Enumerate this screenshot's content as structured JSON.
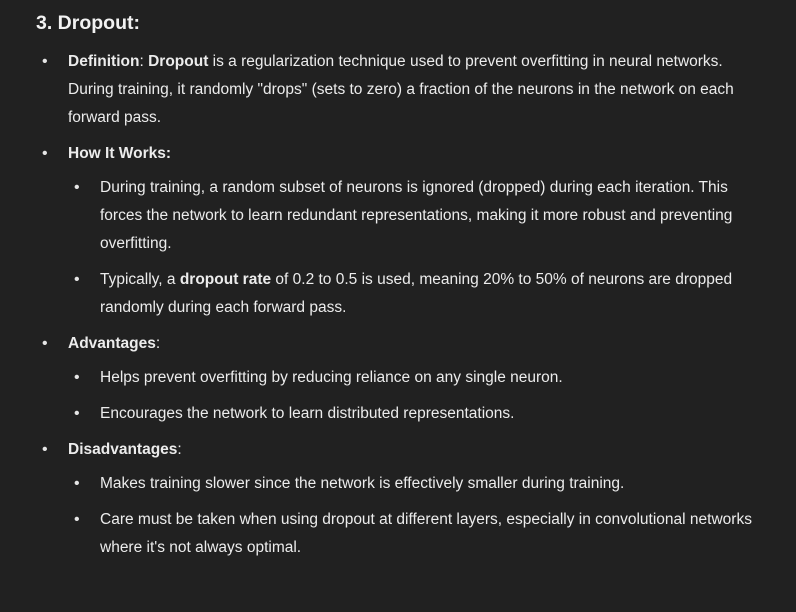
{
  "heading": "3. Dropout:",
  "definition": {
    "label": "Definition",
    "colon": ": ",
    "bold_term": "Dropout",
    "text": " is a regularization technique used to prevent overfitting in neural networks. During training, it randomly \"drops\" (sets to zero) a fraction of the neurons in the network on each forward pass."
  },
  "how_it_works": {
    "label": "How It Works:",
    "items": [
      {
        "text": "During training, a random subset of neurons is ignored (dropped) during each iteration. This forces the network to learn redundant representations, making it more robust and preventing overfitting."
      },
      {
        "prefix": "Typically, a ",
        "bold": "dropout rate",
        "suffix": " of 0.2 to 0.5 is used, meaning 20% to 50% of neurons are dropped randomly during each forward pass."
      }
    ]
  },
  "advantages": {
    "label": "Advantages",
    "colon": ":",
    "items": [
      "Helps prevent overfitting by reducing reliance on any single neuron.",
      "Encourages the network to learn distributed representations."
    ]
  },
  "disadvantages": {
    "label": "Disadvantages",
    "colon": ":",
    "items": [
      "Makes training slower since the network is effectively smaller during training.",
      "Care must be taken when using dropout at different layers, especially in convolutional networks where it's not always optimal."
    ]
  }
}
